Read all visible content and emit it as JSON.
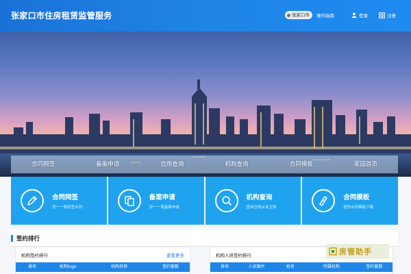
{
  "header": {
    "site_title": "张家口市住房租赁监管服务",
    "city_selector": "张家口市",
    "guide": "操作指南",
    "login": "登录",
    "register": "注册",
    "background_color": "#1f86e8"
  },
  "quick_nav": [
    "合同网签",
    "备案申请",
    "信用查询",
    "机构查询",
    "合同模板",
    "家园首页"
  ],
  "service_cards": [
    {
      "title": "合同网签",
      "subtitle": "双一一笔网签合同",
      "icon": "pen-icon"
    },
    {
      "title": "备案申请",
      "subtitle": "双一一笔备案申请",
      "icon": "copy-icon"
    },
    {
      "title": "机构查询",
      "subtitle": "查阅当地从业主体",
      "icon": "search-icon"
    },
    {
      "title": "合同模板",
      "subtitle": "提供合同模板下载",
      "icon": "document-icon"
    }
  ],
  "ranking": {
    "section_title": "签约排行",
    "org_panel": {
      "title": "机构签约排行",
      "more": "查看更多",
      "columns": [
        "排名",
        "机构logo",
        "机构名称",
        "签约套数"
      ]
    },
    "staff_panel": {
      "title": "机构人员签约排行",
      "columns": [
        "排名",
        "人员图片",
        "姓名",
        "所属机构",
        "签约套数"
      ]
    }
  },
  "watermark": "房管助手",
  "colors": {
    "accent": "#1f86e8",
    "card": "#1fa3ef"
  }
}
